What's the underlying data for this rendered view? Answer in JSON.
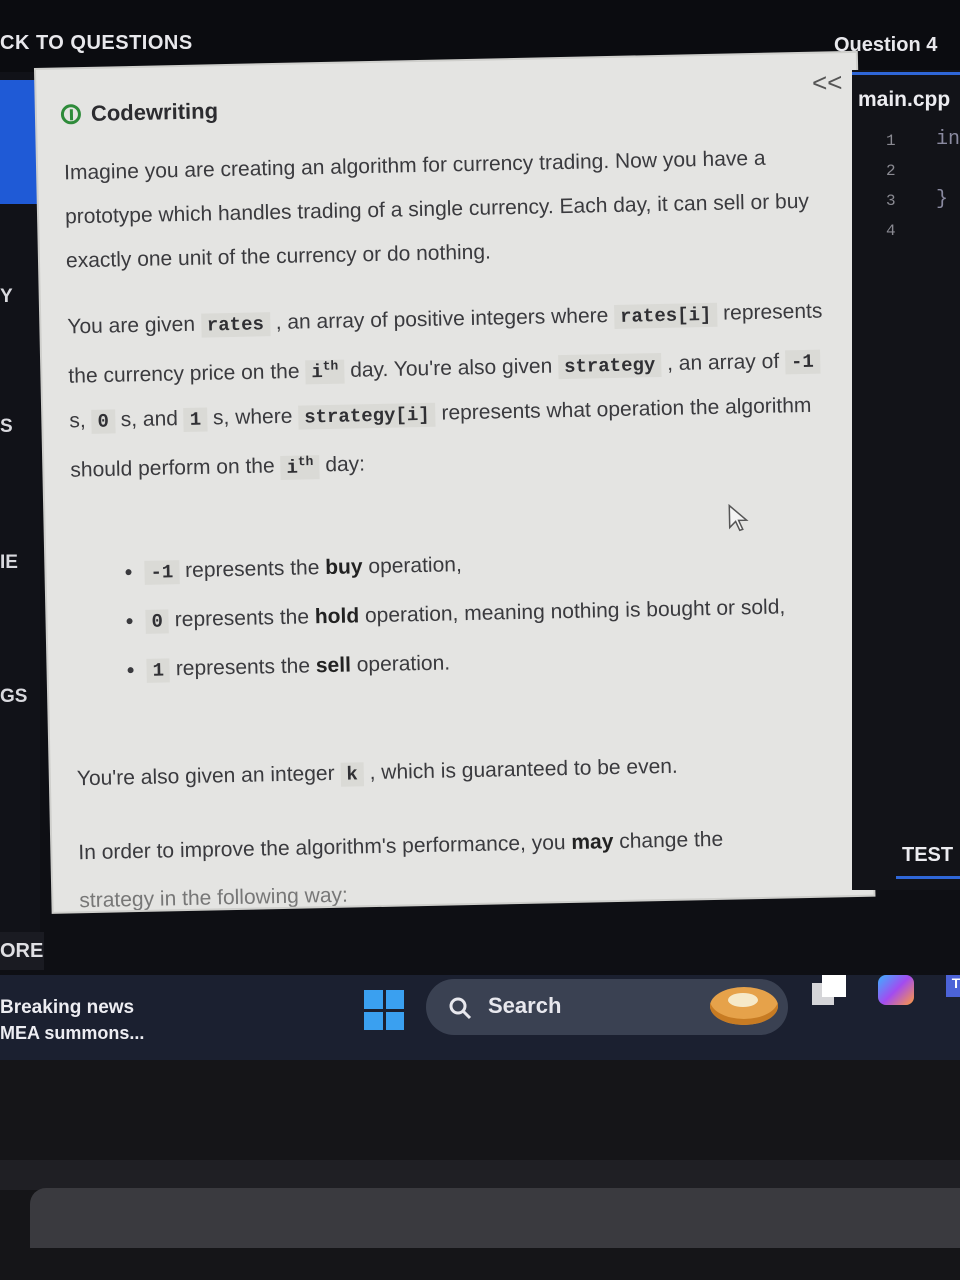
{
  "topbar": {
    "back_label": "CK TO QUESTIONS",
    "question_label": "Question 4"
  },
  "left_nav": {
    "fragments": [
      "Y",
      "S",
      "IE",
      "GS",
      "ORE"
    ]
  },
  "problem": {
    "type_label": "Codewriting",
    "collapse_label": "<<",
    "p1": "Imagine you are creating an algorithm for currency trading. Now you have a prototype which handles trading of a single currency. Each day, it can sell or buy exactly one unit of the currency or do nothing.",
    "p2": {
      "t1": "You are given ",
      "c1": "rates",
      "t2": " , an array of positive integers where ",
      "c2": "rates[i]",
      "t3": " represents the currency price on the ",
      "i1": "i",
      "sup1": "th",
      "t4": " day. You're also given ",
      "c3": "strategy",
      "t5": " , an array of ",
      "c4": "-1",
      "t6": " s, ",
      "c5": "0",
      "t7": " s, and ",
      "c6": "1",
      "t8": " s, where ",
      "c7": "strategy[i]",
      "t9": " represents what operation the algorithm should perform on the ",
      "i2": "i",
      "sup2": "th",
      "t10": " day:"
    },
    "ops": [
      {
        "code": "-1",
        "pre": " represents the ",
        "bold": "buy",
        "post": " operation,"
      },
      {
        "code": "0",
        "pre": " represents the ",
        "bold": "hold",
        "post": " operation, meaning nothing is bought or sold,"
      },
      {
        "code": "1",
        "pre": " represents the ",
        "bold": "sell",
        "post": " operation."
      }
    ],
    "p3": {
      "t1": "You're also given an integer ",
      "c1": "k",
      "t2": " , which is guaranteed to be even."
    },
    "p4": {
      "t1": "In order to improve the algorithm's performance, you ",
      "b1": "may",
      "t2": " change the"
    },
    "p5": "strategy in the following way:"
  },
  "editor": {
    "tab_label": "main.cpp",
    "line_numbers": [
      "1",
      "2",
      "3",
      "4"
    ],
    "line1": "in",
    "line3": "}",
    "tests_tab": "TEST"
  },
  "taskbar": {
    "news_headline": "Breaking news",
    "news_sub": "MEA summons...",
    "search_label": "Search",
    "teams_label": "T"
  }
}
